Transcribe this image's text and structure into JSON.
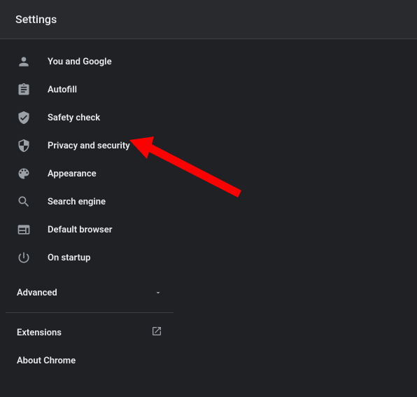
{
  "header": {
    "title": "Settings"
  },
  "sidebar": {
    "items": [
      {
        "label": "You and Google"
      },
      {
        "label": "Autofill"
      },
      {
        "label": "Safety check"
      },
      {
        "label": "Privacy and security"
      },
      {
        "label": "Appearance"
      },
      {
        "label": "Search engine"
      },
      {
        "label": "Default browser"
      },
      {
        "label": "On startup"
      }
    ],
    "advanced_label": "Advanced",
    "extensions_label": "Extensions",
    "about_label": "About Chrome"
  }
}
